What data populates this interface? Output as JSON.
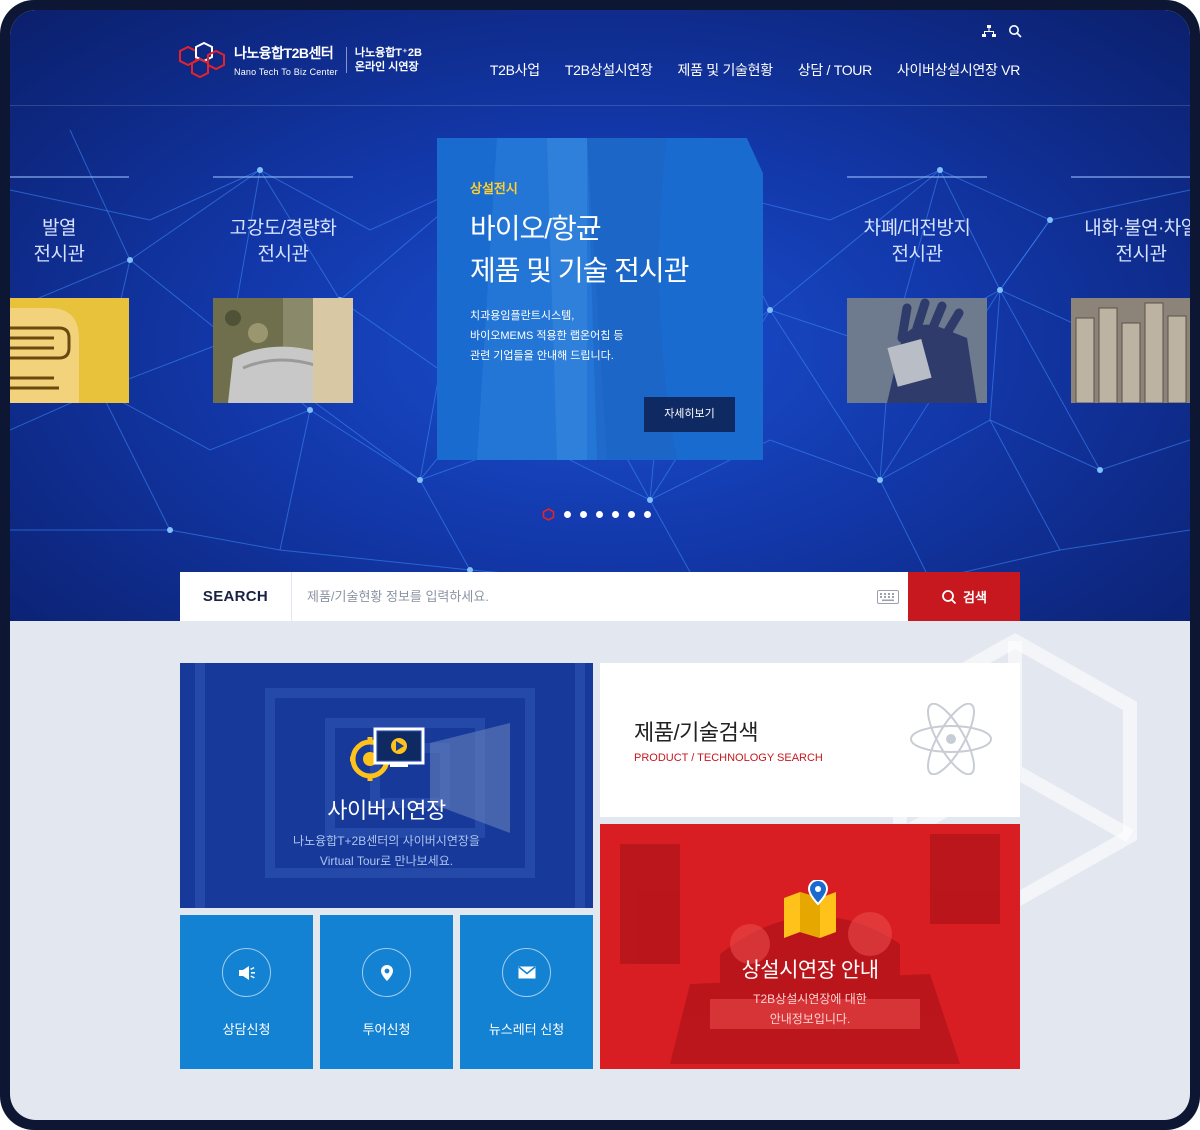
{
  "header": {
    "logo_line1": "나노융합T2B센터",
    "logo_line2": "Nano Tech To Biz Center",
    "logo_right1": "나노융합T⁺2B",
    "logo_right2": "온라인 시연장",
    "util_icons": [
      "sitemap-icon",
      "search-icon"
    ],
    "nav": [
      "T2B사업",
      "T2B상설시연장",
      "제품 및 기술현황",
      "상담 / TOUR",
      "사이버상설시연장 VR"
    ]
  },
  "hero": {
    "left_exhibits": [
      {
        "title_line1": "발열",
        "title_line2": "전시관"
      },
      {
        "title_line1": "고강도/경량화",
        "title_line2": "전시관"
      }
    ],
    "right_exhibits": [
      {
        "title_line1": "차폐/대전방지",
        "title_line2": "전시관"
      },
      {
        "title_line1": "내화·불연·차열",
        "title_line2": "전시관"
      }
    ],
    "card": {
      "category": "상설전시",
      "title_line1": "바이오/항균",
      "title_line2": "제품 및 기술 전시관",
      "desc_line1": "치과용임플란트시스템,",
      "desc_line2": "바이오MEMS 적용한 랩온어칩 등",
      "desc_line3": "관련 기업들을 안내해 드립니다.",
      "more_label": "자세히보기"
    },
    "slide_count": 7,
    "active_slide": 1
  },
  "search": {
    "label": "SEARCH",
    "placeholder": "제품/기술현황 정보를 입력하세요.",
    "button_label": "검색"
  },
  "tiles": {
    "cyber": {
      "title": "사이버시연장",
      "desc_line1": "나노융합T+2B센터의 사이버시연장을",
      "desc_line2": "Virtual Tour로 만나보세요."
    },
    "quick": [
      {
        "label": "상담신청",
        "icon": "megaphone-icon"
      },
      {
        "label": "투어신청",
        "icon": "location-pin-icon"
      },
      {
        "label": "뉴스레터 신청",
        "icon": "envelope-icon"
      }
    ],
    "product_search": {
      "title": "제품/기술검색",
      "subtitle": "PRODUCT / TECHNOLOGY SEARCH"
    },
    "guide": {
      "title": "상설시연장 안내",
      "desc_line1": "T2B상설시연장에 대한",
      "desc_line2": "안내정보입니다."
    }
  },
  "colors": {
    "brand_red": "#c7171f",
    "hero_blue": "#1237a8",
    "card_blue": "#1a6bd0",
    "quick_blue": "#1482d2",
    "accent_yellow": "#ffcf2e"
  }
}
